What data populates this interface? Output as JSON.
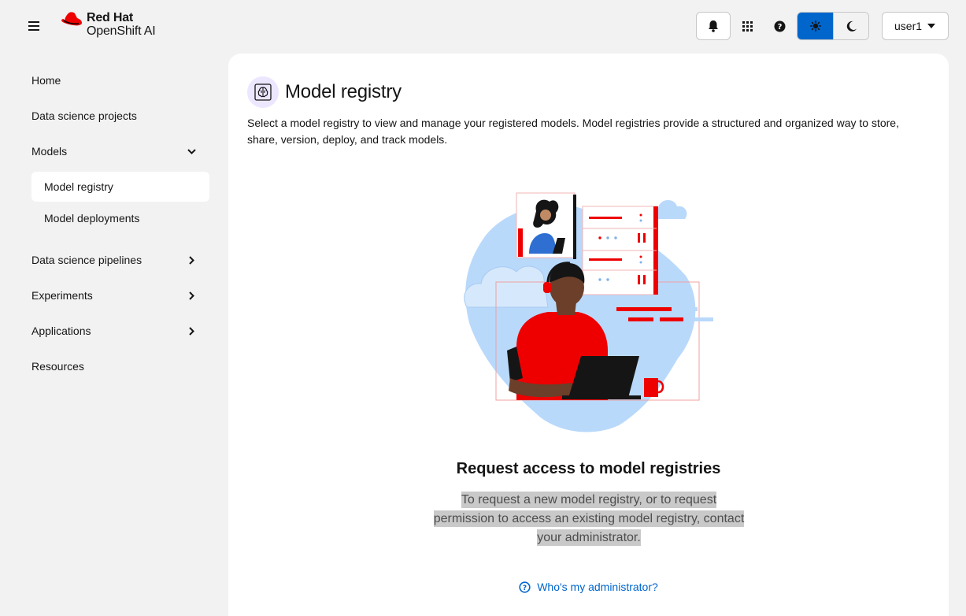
{
  "masthead": {
    "brand_line1": "Red Hat",
    "brand_line2": "OpenShift AI",
    "user_label": "user1",
    "icons": {
      "menu": "hamburger-icon",
      "notifications": "bell-icon",
      "apps": "grid-icon",
      "help": "question-circle-icon",
      "light_theme": "sun-icon",
      "dark_theme": "moon-icon",
      "user_dropdown": "caret-down-icon"
    },
    "theme_active_color": "#0066cc",
    "brand_color": "#ee0000"
  },
  "sidebar": {
    "items": [
      {
        "label": "Home"
      },
      {
        "label": "Data science projects"
      },
      {
        "label": "Models",
        "expanded": true
      },
      {
        "label": "Model registry",
        "active": true
      },
      {
        "label": "Model deployments"
      },
      {
        "label": "Data science pipelines"
      },
      {
        "label": "Experiments"
      },
      {
        "label": "Applications"
      },
      {
        "label": "Resources"
      }
    ]
  },
  "main": {
    "title": "Model registry",
    "title_icon": "model-registry-icon",
    "description": "Select a model registry to view and manage your registered models. Model registries provide a structured and organized way to store, share, version, deploy, and track models.",
    "empty_state": {
      "title": "Request access to model registries",
      "body": "To request a new model registry, or to request permission to access an existing model registry, contact your administrator.",
      "link_label": "Who's my administrator?",
      "link_icon": "question-circle-icon"
    }
  }
}
